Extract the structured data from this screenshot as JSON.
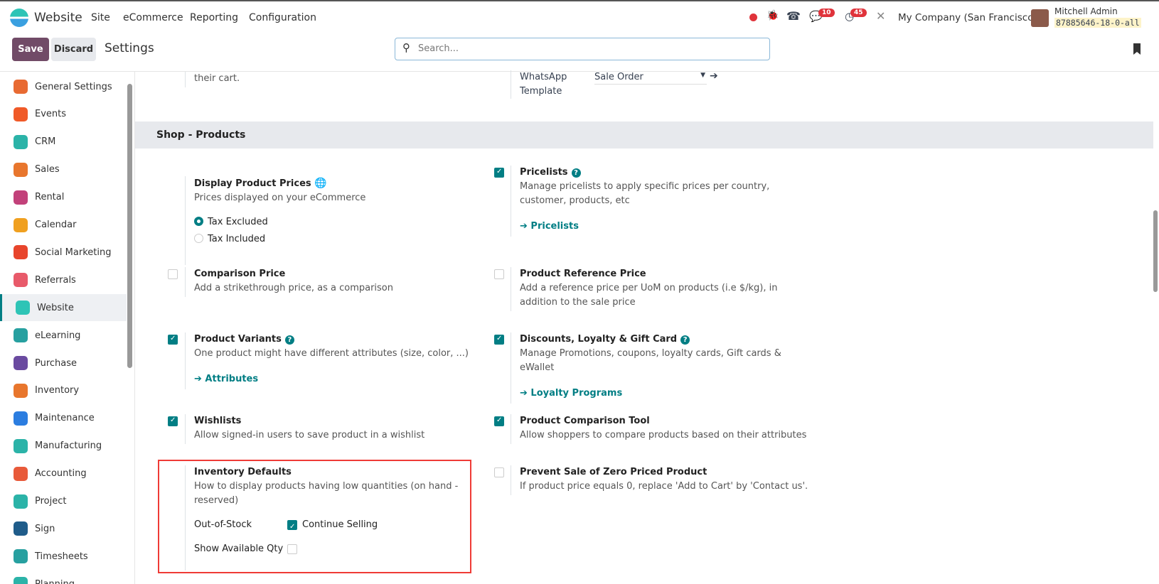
{
  "topbar": {
    "app_name": "Website",
    "menu": [
      "Site",
      "eCommerce",
      "Reporting",
      "Configuration"
    ],
    "chat_count": "10",
    "activity_count": "45",
    "company": "My Company (San Francisco)",
    "user_name": "Mitchell Admin",
    "db_name": "87885646-18-0-all"
  },
  "control": {
    "save": "Save",
    "discard": "Discard",
    "title": "Settings",
    "search_placeholder": "Search..."
  },
  "sidebar": {
    "items": [
      {
        "label": "General Settings",
        "color": "#e86a32"
      },
      {
        "label": "Events",
        "color": "#f05a28"
      },
      {
        "label": "CRM",
        "color": "#2bb3a8"
      },
      {
        "label": "Sales",
        "color": "#e8762d"
      },
      {
        "label": "Rental",
        "color": "#c2417a"
      },
      {
        "label": "Calendar",
        "color": "#f0a020"
      },
      {
        "label": "Social Marketing",
        "color": "#e8452c"
      },
      {
        "label": "Referrals",
        "color": "#e85a6a"
      },
      {
        "label": "Website",
        "color": "#2ec4b6"
      },
      {
        "label": "eLearning",
        "color": "#27a0a0"
      },
      {
        "label": "Purchase",
        "color": "#6a4aa0"
      },
      {
        "label": "Inventory",
        "color": "#e8762d"
      },
      {
        "label": "Maintenance",
        "color": "#2b7de0"
      },
      {
        "label": "Manufacturing",
        "color": "#2bb3a8"
      },
      {
        "label": "Accounting",
        "color": "#e85a3a"
      },
      {
        "label": "Project",
        "color": "#2bb3a8"
      },
      {
        "label": "Sign",
        "color": "#1f5c8a"
      },
      {
        "label": "Timesheets",
        "color": "#27a0a0"
      },
      {
        "label": "Planning",
        "color": "#2bb3a8"
      }
    ],
    "active": "Website"
  },
  "top_partial": {
    "cart_text": "their cart.",
    "whatsapp_label_1": "WhatsApp",
    "whatsapp_label_2": "Template",
    "whatsapp_value": "Sale Order"
  },
  "section": {
    "title": "Shop - Products"
  },
  "settings": {
    "display_prices": {
      "title": "Display Product Prices",
      "desc": "Prices displayed on your eCommerce",
      "opt1": "Tax Excluded",
      "opt2": "Tax Included",
      "selected": "Tax Excluded"
    },
    "pricelists": {
      "title": "Pricelists",
      "desc1": "Manage pricelists to apply specific prices per country,",
      "desc2": "customer, products, etc",
      "link": "Pricelists",
      "checked": true
    },
    "comparison": {
      "title": "Comparison Price",
      "desc": "Add a strikethrough price, as a comparison",
      "checked": false
    },
    "reference": {
      "title": "Product Reference Price",
      "desc1": "Add a reference price per UoM on products (i.e $/kg), in",
      "desc2": "addition to the sale price",
      "checked": false
    },
    "variants": {
      "title": "Product Variants",
      "desc": "One product might have different attributes (size, color, ...)",
      "link": "Attributes",
      "checked": true
    },
    "loyalty": {
      "title": "Discounts, Loyalty & Gift Card",
      "desc1": "Manage Promotions, coupons, loyalty cards, Gift cards &",
      "desc2": "eWallet",
      "link": "Loyalty Programs",
      "checked": true
    },
    "wishlists": {
      "title": "Wishlists",
      "desc": "Allow signed-in users to save product in a wishlist",
      "checked": true
    },
    "comparison_tool": {
      "title": "Product Comparison Tool",
      "desc": "Allow shoppers to compare products based on their attributes",
      "checked": true
    },
    "inventory": {
      "title": "Inventory Defaults",
      "desc1": "How to display products having low quantities (on hand -",
      "desc2": "reserved)",
      "oos_label": "Out-of-Stock",
      "continue_label": "Continue Selling",
      "continue_checked": true,
      "show_qty_label": "Show Available Qty",
      "show_qty_checked": false
    },
    "zero_price": {
      "title": "Prevent Sale of Zero Priced Product",
      "desc": "If product price equals 0, replace 'Add to Cart' by 'Contact us'.",
      "checked": false
    }
  }
}
